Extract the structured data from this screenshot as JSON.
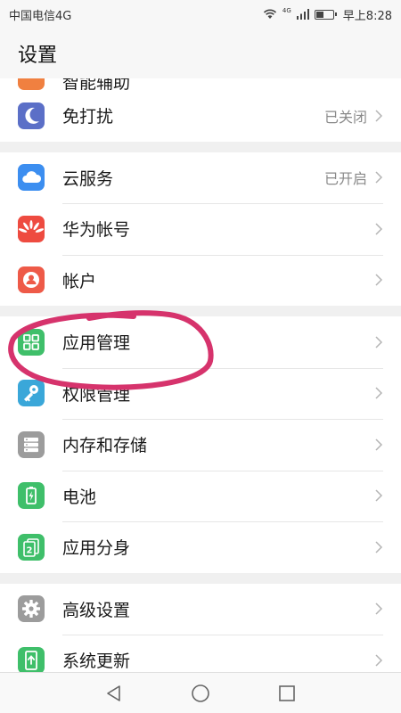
{
  "status_bar": {
    "carrier": "中国电信4G",
    "network": "4G",
    "time": "早上8:28"
  },
  "header": {
    "title": "设置"
  },
  "partial_item": {
    "label": "智能辅助",
    "icon": "orange-assist-icon",
    "color": "#f08040"
  },
  "groups": [
    [
      {
        "label": "免打扰",
        "status": "已关闭",
        "icon": "moon-icon",
        "color": "#5b6fc7"
      }
    ],
    [
      {
        "label": "云服务",
        "status": "已开启",
        "icon": "cloud-icon",
        "color": "#3c8ef0"
      },
      {
        "label": "华为帐号",
        "status": "",
        "icon": "huawei-icon",
        "color": "#ee4b40"
      },
      {
        "label": "帐户",
        "status": "",
        "icon": "user-icon",
        "color": "#ee5a48"
      }
    ],
    [
      {
        "label": "应用管理",
        "status": "",
        "icon": "apps-grid-icon",
        "color": "#3fbf6a"
      },
      {
        "label": "权限管理",
        "status": "",
        "icon": "key-icon",
        "color": "#3aa7d9"
      },
      {
        "label": "内存和存储",
        "status": "",
        "icon": "storage-icon",
        "color": "#9c9c9c"
      },
      {
        "label": "电池",
        "status": "",
        "icon": "battery-icon",
        "color": "#3fbf6a"
      },
      {
        "label": "应用分身",
        "status": "",
        "icon": "app-twin-icon",
        "color": "#3fbf6a"
      }
    ],
    [
      {
        "label": "高级设置",
        "status": "",
        "icon": "gear-icon",
        "color": "#9c9c9c"
      },
      {
        "label": "系统更新",
        "status": "",
        "icon": "system-update-icon",
        "color": "#3fbf6a"
      }
    ]
  ],
  "annotation": {
    "color": "#d6336c"
  }
}
